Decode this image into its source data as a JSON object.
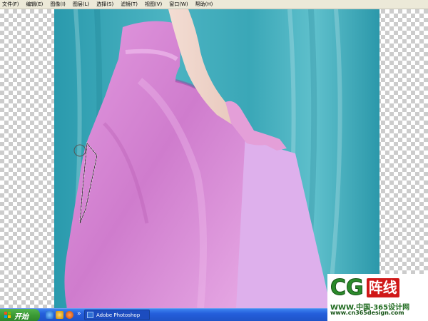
{
  "menu": {
    "items": [
      "文件(F)",
      "编辑(E)",
      "图像(I)",
      "图层(L)",
      "选择(S)",
      "滤镜(T)",
      "视图(V)",
      "窗口(W)",
      "帮助(H)"
    ]
  },
  "taskbar": {
    "start_label": "开始",
    "quick_launch": [
      "ie-icon",
      "outlook-icon",
      "media-icon"
    ],
    "tasks": [
      "Adobe Photoshop"
    ]
  },
  "watermark": {
    "logo_letters": "CG",
    "logo_cn": "阵线",
    "line1": "WWW.中国-365设计网",
    "line2": "www.cn365design.com"
  },
  "colors": {
    "dress_pink": "#d88ad5",
    "fill_lilac": "#deb0ec",
    "background_teal": "#3aa9b9",
    "taskbar_blue": "#245edb",
    "start_green": "#3b9a35"
  }
}
